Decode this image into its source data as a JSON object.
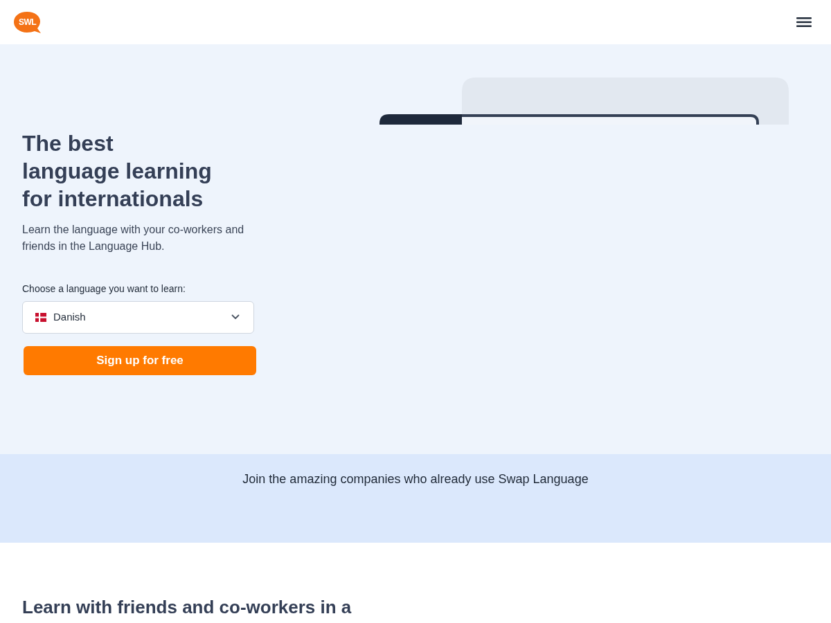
{
  "header": {
    "logo_text": "SWL"
  },
  "hero": {
    "title_lines": [
      "The best",
      "language learning",
      "for internationals"
    ],
    "subtitle": "Learn the language with your co-workers and friends in the Language Hub.",
    "language_select": {
      "label": "Choose a language you want to learn:",
      "value": "Danish"
    },
    "signup_button": "Sign up for free"
  },
  "companies_band": {
    "text": "Join the amazing companies who already use Swap Language"
  },
  "features": {
    "heading": "Learn with friends and co-workers in a"
  }
}
